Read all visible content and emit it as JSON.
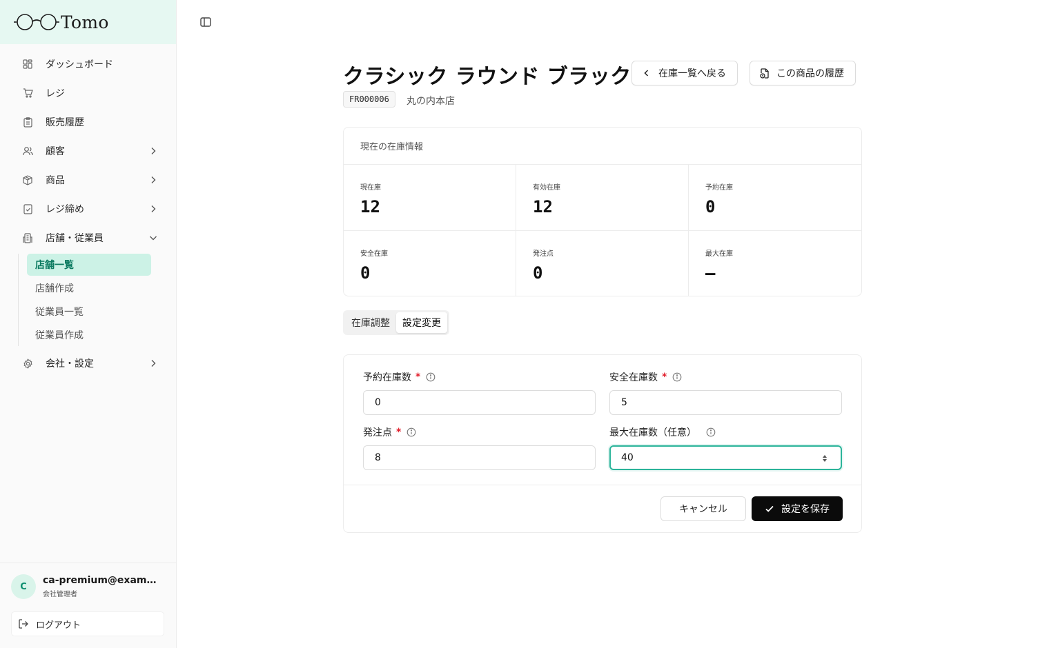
{
  "app": {
    "brand": "Tomo",
    "accent_color": "#2bb49a",
    "brand_bg_color": "#e6f8f2"
  },
  "sidebar": {
    "items": [
      {
        "label": "ダッシュボード",
        "icon": "dashboard-grid-icon"
      },
      {
        "label": "レジ",
        "icon": "cart-icon"
      },
      {
        "label": "販売履歴",
        "icon": "receipt-clipboard-icon"
      },
      {
        "label": "顧客",
        "icon": "users-icon",
        "expandable": true
      },
      {
        "label": "商品",
        "icon": "box-icon",
        "expandable": true
      },
      {
        "label": "レジ締め",
        "icon": "checklist-icon",
        "expandable": true
      },
      {
        "label": "店舗・従業員",
        "icon": "building-icon",
        "expanded": true
      },
      {
        "label": "会社・設定",
        "icon": "gear-icon",
        "expandable": true
      }
    ],
    "sub_items": [
      {
        "label": "店舗一覧",
        "active": true
      },
      {
        "label": "店舗作成"
      },
      {
        "label": "従業員一覧"
      },
      {
        "label": "従業員作成"
      }
    ],
    "user": {
      "initial": "C",
      "email": "ca-premium@example.com",
      "role": "会社管理者"
    },
    "logout_label": "ログアウト"
  },
  "header": {
    "title": "クラシック ラウンド ブラック",
    "back_button": "在庫一覧へ戻る",
    "history_button": "この商品の履歴",
    "sku": "FR000006",
    "store": "丸の内本店"
  },
  "inventory": {
    "title": "現在の在庫情報",
    "stats": [
      {
        "label": "現在庫",
        "value": "12"
      },
      {
        "label": "有効在庫",
        "value": "12"
      },
      {
        "label": "予約在庫",
        "value": "0"
      },
      {
        "label": "安全在庫",
        "value": "0"
      },
      {
        "label": "発注点",
        "value": "0"
      },
      {
        "label": "最大在庫",
        "value": "—"
      }
    ]
  },
  "tabs": [
    {
      "label": "在庫調整",
      "active": false
    },
    {
      "label": "設定変更",
      "active": true
    }
  ],
  "form": {
    "reserved": {
      "label": "予約在庫数",
      "required_mark": "*",
      "value": "0"
    },
    "safety": {
      "label": "安全在庫数",
      "required_mark": "*",
      "value": "5"
    },
    "reorder": {
      "label": "発注点",
      "required_mark": "*",
      "value": "8"
    },
    "max": {
      "label": "最大在庫数（任意）",
      "value": "40"
    },
    "cancel_label": "キャンセル",
    "save_label": "設定を保存"
  }
}
